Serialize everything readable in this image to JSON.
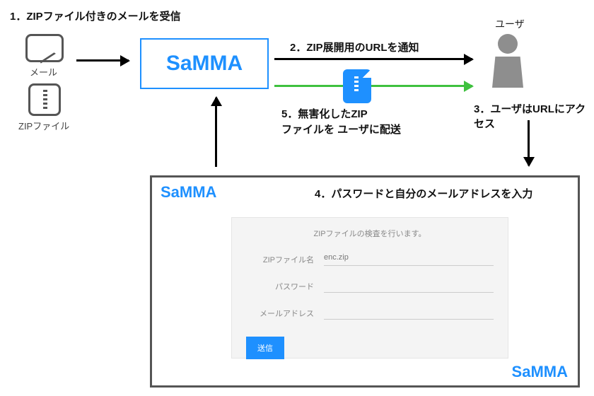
{
  "steps": {
    "s1": "1．ZIPファイル付きのメールを受信",
    "s2": "2．ZIP展開用のURLを通知",
    "s3": "3．ユーザはURLにアクセス",
    "s4": "4．パスワードと自分のメールアドレスを入力",
    "s5_line1": "5．無害化したZIP",
    "s5_line2": "ファイルを ユーザに配送"
  },
  "labels": {
    "mail": "メール",
    "zipfile": "ZIPファイル",
    "user": "ユーザ",
    "samma": "SaMMA"
  },
  "viewer": {
    "brand": "SaMMA",
    "footer_brand": "SaMMA",
    "form": {
      "heading": "ZIPファイルの検査を行います。",
      "row_zipname_label": "ZIPファイル名",
      "row_zipname_value": "enc.zip",
      "row_password_label": "パスワード",
      "row_password_value": "",
      "row_mail_label": "メールアドレス",
      "row_mail_value": "",
      "submit": "送信"
    }
  }
}
